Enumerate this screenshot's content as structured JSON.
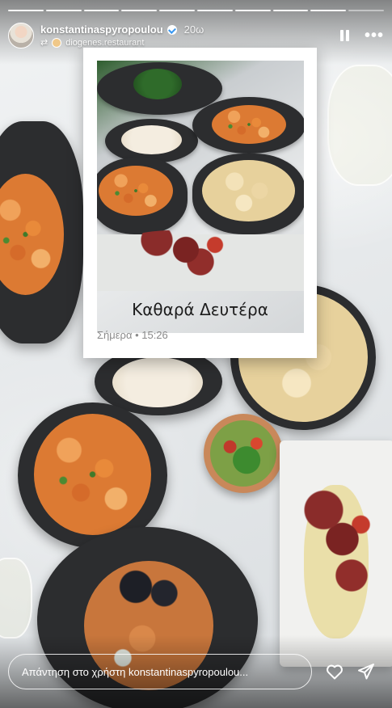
{
  "story": {
    "username": "konstantinaspyropoulou",
    "time_ago": "20ω",
    "repost_source": "diogenes.restaurant",
    "progress_segments": 10,
    "progress_active_index": 9
  },
  "card": {
    "caption": "Καθαρά Δευτέρα",
    "meta": "Σήμερα • 15:26"
  },
  "reply": {
    "placeholder": "Απάντηση στο χρήστη konstantinaspyropoulou..."
  },
  "icons": {
    "verified": "verified-badge-icon",
    "repost": "repost-icon",
    "pause": "pause-icon",
    "more": "more-icon",
    "heart": "heart-icon",
    "send": "send-icon"
  },
  "colors": {
    "text_on_media": "#ffffff",
    "card_background": "#ffffff",
    "verified_blue": "#3897f0"
  }
}
